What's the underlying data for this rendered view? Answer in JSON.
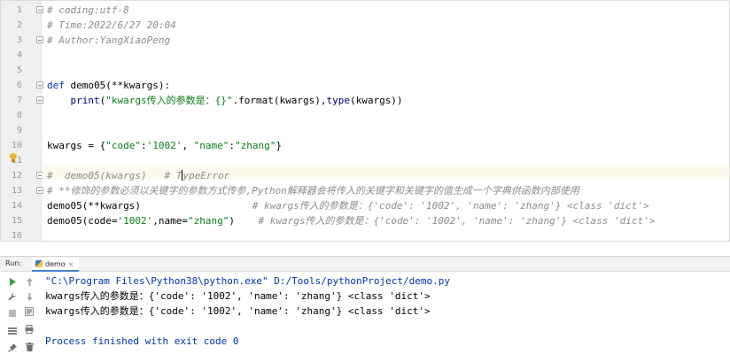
{
  "editor": {
    "line_numbers": [
      "1",
      "2",
      "3",
      "4",
      "5",
      "6",
      "7",
      "8",
      "9",
      "10",
      "11",
      "12",
      "13",
      "14",
      "15",
      "16"
    ],
    "lines": [
      {
        "comment": "# coding:utf-8"
      },
      {
        "comment": "# Time:2022/6/27 20:04"
      },
      {
        "comment": "# Author:YangXiaoPeng"
      },
      {},
      {},
      {
        "kw": "def ",
        "rest": "demo05(**kwargs):"
      },
      {
        "indent": "    ",
        "fn": "print",
        "open": "(",
        "str": "\"kwargs传入的参数是：{}\"",
        "mid": ".format(kwargs),",
        "fn2": "type",
        "tail": "(kwargs))"
      },
      {},
      {},
      {
        "a": "kwargs = {",
        "s1": "\"code\"",
        "b": ":",
        "s2": "'1002'",
        "c": ", ",
        "s3": "\"name\"",
        "d": ":",
        "s4": "\"zhang\"",
        "e": "}"
      },
      {},
      {
        "before": "#  demo05(kwargs)   # T",
        "after": "ypeError"
      },
      {
        "comment": "# **修饰的参数必须以关键字的参数方式传参,Python解释器会将传入的关键字和关键字的值生成一个字典供函数内部使用"
      },
      {
        "code": "demo05(**kwargs)                   ",
        "comment": "# kwargs传入的参数是：{'code': '1002', 'name': 'zhang'} <class 'dict'>"
      },
      {
        "a": "demo05(code=",
        "s1": "'1002'",
        "b": ",name=",
        "s2": "\"zhang\"",
        "c": ")    ",
        "comment": "# kwargs传入的参数是：{'code': '1002', 'name': 'zhang'} <class 'dict'>"
      },
      {}
    ]
  },
  "run": {
    "label": "Run:",
    "tab_label": "demo",
    "tab_close": "×",
    "output": [
      "\"C:\\Program Files\\Python38\\python.exe\" D:/Tools/pythonProject/demo.py",
      "kwargs传入的参数是：{'code': '1002', 'name': 'zhang'} <class 'dict'>",
      "kwargs传入的参数是：{'code': '1002', 'name': 'zhang'} <class 'dict'>",
      "",
      "Process finished with exit code 0"
    ]
  },
  "icons": {
    "run": "play-icon",
    "scroll_up": "arrow-up-icon",
    "settings": "wrench-icon",
    "scroll_down": "arrow-down-icon",
    "stop": "stop-icon",
    "soft_wrap": "soft-wrap-icon",
    "layout": "layout-icon",
    "print": "print-icon",
    "pin": "pin-icon",
    "delete": "trash-icon"
  },
  "colors": {
    "keyword": "#0033b3",
    "string": "#067d17",
    "comment": "#8c8c8c",
    "builtin": "#000080",
    "caret_line": "#fcfaed",
    "tab_underline": "#4083c9"
  }
}
